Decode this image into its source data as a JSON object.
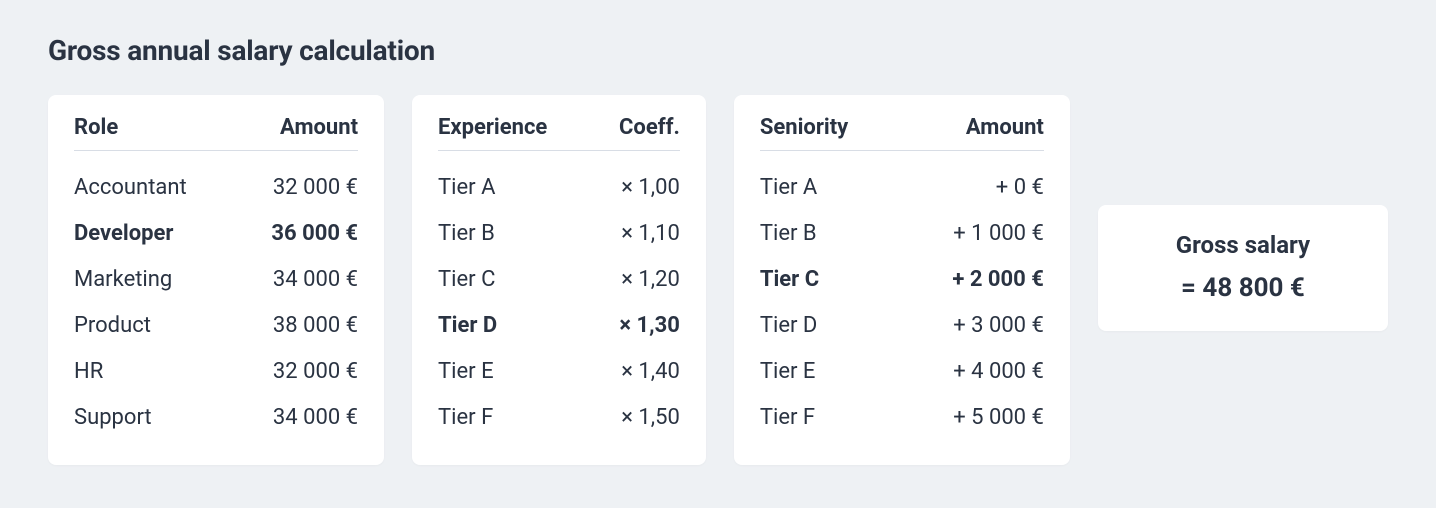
{
  "title": "Gross annual salary calculation",
  "role": {
    "header_label": "Role",
    "header_value": "Amount",
    "selected_index": 1,
    "rows": [
      {
        "label": "Accountant",
        "value": "32 000 €"
      },
      {
        "label": "Developer",
        "value": "36 000 €"
      },
      {
        "label": "Marketing",
        "value": "34 000 €"
      },
      {
        "label": "Product",
        "value": "38 000 €"
      },
      {
        "label": "HR",
        "value": "32 000 €"
      },
      {
        "label": "Support",
        "value": "34 000 €"
      }
    ]
  },
  "experience": {
    "header_label": "Experience",
    "header_value": "Coeff.",
    "selected_index": 3,
    "rows": [
      {
        "label": "Tier A",
        "value": "× 1,00"
      },
      {
        "label": "Tier B",
        "value": "× 1,10"
      },
      {
        "label": "Tier C",
        "value": "× 1,20"
      },
      {
        "label": "Tier D",
        "value": "× 1,30"
      },
      {
        "label": "Tier E",
        "value": "× 1,40"
      },
      {
        "label": "Tier F",
        "value": "× 1,50"
      }
    ]
  },
  "seniority": {
    "header_label": "Seniority",
    "header_value": "Amount",
    "selected_index": 2,
    "rows": [
      {
        "label": "Tier A",
        "value": "+ 0 €"
      },
      {
        "label": "Tier B",
        "value": "+ 1 000 €"
      },
      {
        "label": "Tier C",
        "value": "+ 2 000 €"
      },
      {
        "label": "Tier D",
        "value": "+ 3 000 €"
      },
      {
        "label": "Tier E",
        "value": "+ 4 000 €"
      },
      {
        "label": "Tier F",
        "value": "+ 5 000 €"
      }
    ]
  },
  "result": {
    "label": "Gross salary",
    "value": "= 48 800 €"
  }
}
